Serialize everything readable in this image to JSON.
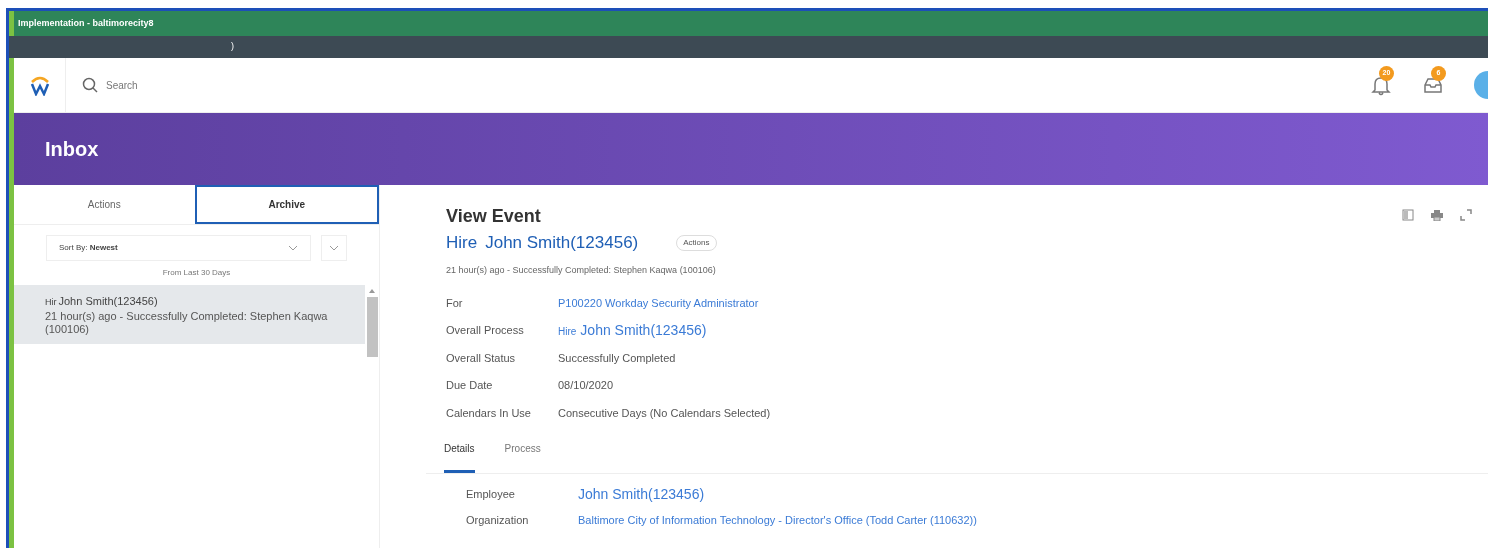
{
  "window": {
    "title": "Implementation - baltimorecity8",
    "toolbar_text": ")"
  },
  "header": {
    "search": {
      "placeholder": "Search"
    },
    "notifications": {
      "badge": "20"
    },
    "inbox": {
      "badge": "6"
    }
  },
  "banner": {
    "title": "Inbox"
  },
  "tabs": [
    {
      "label": "Actions",
      "selected": false
    },
    {
      "label": "Archive",
      "selected": true
    }
  ],
  "sort": {
    "value": "Sort By: ",
    "bold": "Newest"
  },
  "filter_note": "From Last 30 Days",
  "list": [
    {
      "prefix": "Hir",
      "name": "John Smith(123456)",
      "summary": "21 hour(s) ago - Successfully Completed: Stephen Kaqwa (100106)",
      "selected": true
    }
  ],
  "event": {
    "heading": "View Event",
    "type": "Hire",
    "name": "John Smith(123456)",
    "actions": "Actions",
    "summary": "21 hour(s) ago - Successfully Completed: Stephen Kaqwa (100106)",
    "fields": [
      {
        "label": "For",
        "kind": "link",
        "value": "P100220 Workday Security Administrator"
      },
      {
        "label": "Overall Process",
        "kind": "process",
        "prefix": "Hire",
        "value": "John Smith(123456)"
      },
      {
        "label": "Overall Status",
        "kind": "text",
        "value": "Successfully Completed"
      },
      {
        "label": "Due Date",
        "kind": "text",
        "value": "08/10/2020"
      },
      {
        "label": "Calendars In Use",
        "kind": "text",
        "value": "Consecutive Days (No Calendars Selected)"
      }
    ],
    "detail_tabs": [
      {
        "label": "Details",
        "selected": true
      },
      {
        "label": "Process",
        "selected": false
      }
    ],
    "details": [
      {
        "label": "Employee",
        "kind": "biglink",
        "value": "John Smith(123456)"
      },
      {
        "label": "Organization",
        "kind": "link",
        "value": "Baltimore City of Information Technology - Director's Office (Todd Carter (110632))"
      }
    ]
  }
}
